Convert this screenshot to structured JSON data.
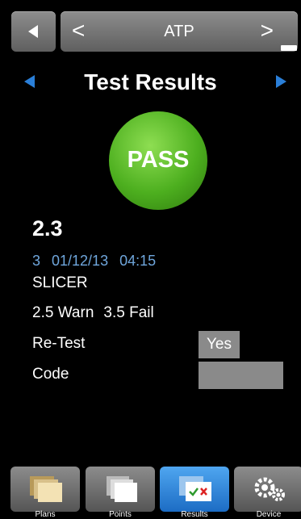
{
  "header": {
    "selector_title": "ATP",
    "prev_glyph": "<",
    "next_glyph": ">"
  },
  "page": {
    "title": "Test Results"
  },
  "result": {
    "status": "PASS",
    "status_color": "#4daf1f",
    "value": "2.3",
    "point_number": "3",
    "date": "01/12/13",
    "time": "04:15",
    "location": "SLICER",
    "warn": "2.5 Warn",
    "fail": "3.5 Fail",
    "retest_label": "Re-Test",
    "retest_value": "Yes",
    "code_label": "Code",
    "code_value": ""
  },
  "tabs": [
    {
      "label": "Plans",
      "icon": "folders-icon"
    },
    {
      "label": "Points",
      "icon": "pages-icon"
    },
    {
      "label": "Results",
      "icon": "results-checklist-icon",
      "active": true
    },
    {
      "label": "Device",
      "icon": "gears-icon"
    }
  ],
  "colors": {
    "accent": "#2a7fd8",
    "meta_text": "#6fa6dc"
  }
}
